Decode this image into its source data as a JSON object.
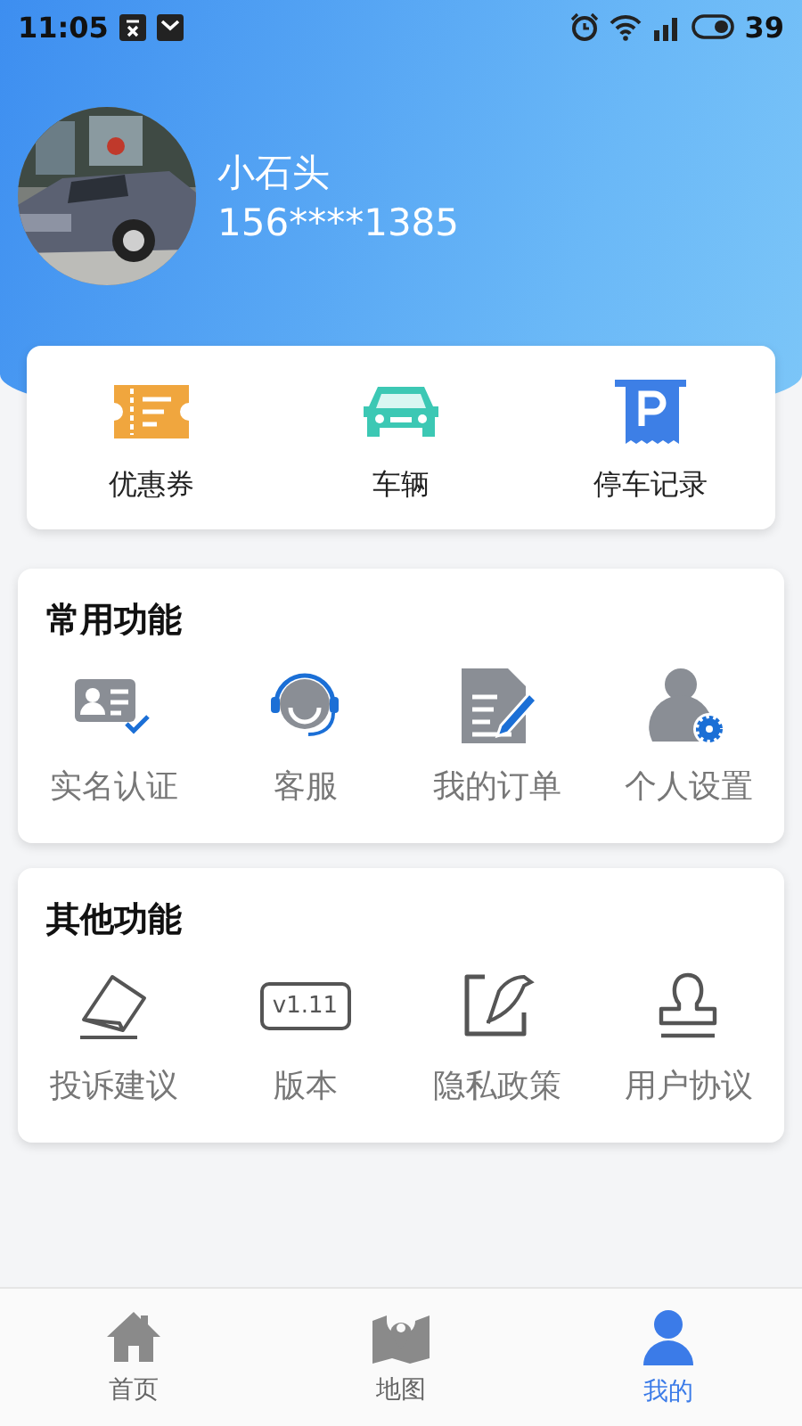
{
  "status_bar": {
    "time": "11:05",
    "battery": "39"
  },
  "profile": {
    "name": "小石头",
    "phone": "156****1385"
  },
  "quick_links": [
    {
      "label": "优惠券"
    },
    {
      "label": "车辆"
    },
    {
      "label": "停车记录"
    }
  ],
  "sections": [
    {
      "title": "常用功能",
      "items": [
        {
          "label": "实名认证"
        },
        {
          "label": "客服"
        },
        {
          "label": "我的订单"
        },
        {
          "label": "个人设置"
        }
      ]
    },
    {
      "title": "其他功能",
      "items": [
        {
          "label": "投诉建议"
        },
        {
          "label": "版本",
          "badge": "v1.11"
        },
        {
          "label": "隐私政策"
        },
        {
          "label": "用户协议"
        }
      ]
    }
  ],
  "tab_bar": [
    {
      "label": "首页",
      "selected": false
    },
    {
      "label": "地图",
      "selected": false
    },
    {
      "label": "我的",
      "selected": true
    }
  ]
}
